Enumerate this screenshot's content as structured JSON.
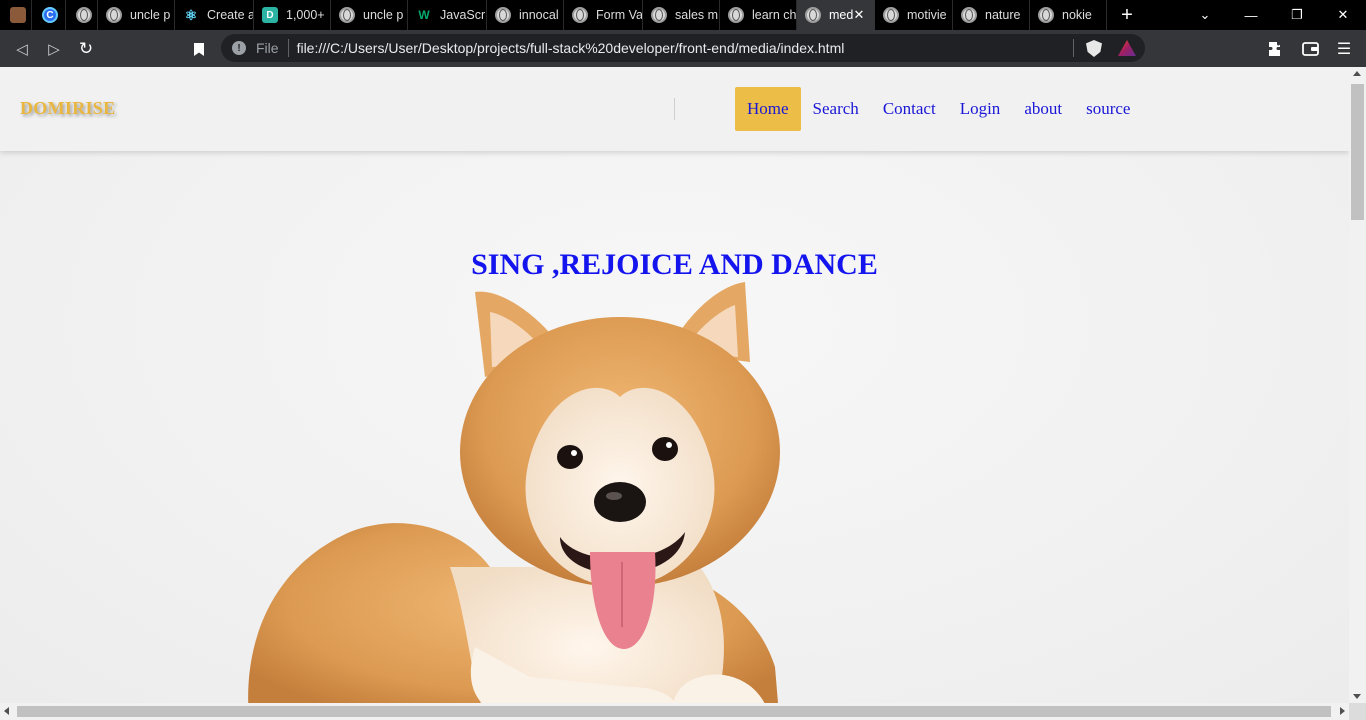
{
  "browser": {
    "tabs": [
      {
        "title": "",
        "icon": "avatar-favicon-icon",
        "pinned": true
      },
      {
        "title": "",
        "icon": "c-favicon-icon",
        "pinned": true
      },
      {
        "title": "",
        "icon": "globe-icon",
        "pinned": true
      },
      {
        "title": "uncle p",
        "icon": "globe-icon"
      },
      {
        "title": "Create a",
        "icon": "react-icon"
      },
      {
        "title": "1,000+",
        "icon": "d-favicon-icon"
      },
      {
        "title": "uncle p",
        "icon": "globe-icon"
      },
      {
        "title": "JavaScr",
        "icon": "w3-icon"
      },
      {
        "title": "innocal",
        "icon": "globe-icon"
      },
      {
        "title": "Form Va",
        "icon": "globe-icon"
      },
      {
        "title": "sales m",
        "icon": "globe-icon"
      },
      {
        "title": "learn ch",
        "icon": "globe-icon"
      },
      {
        "title": "med",
        "icon": "globe-icon",
        "active": true
      },
      {
        "title": "motivie",
        "icon": "globe-icon"
      },
      {
        "title": "nature",
        "icon": "globe-icon"
      },
      {
        "title": "nokie",
        "icon": "globe-icon"
      }
    ],
    "new_tab": "+",
    "window_controls": {
      "dropdown": "⌄",
      "minimize": "—",
      "restore": "❐",
      "close": "✕"
    },
    "address_bar": {
      "scheme_label": "File",
      "url": "file:///C:/Users/User/Desktop/projects/full-stack%20developer/front-end/media/index.html"
    }
  },
  "site": {
    "logo": "DOMIRISE",
    "nav": [
      {
        "label": "Home",
        "active": true
      },
      {
        "label": "Search"
      },
      {
        "label": "Contact"
      },
      {
        "label": "Login"
      },
      {
        "label": "about"
      },
      {
        "label": "source"
      }
    ],
    "hero": {
      "title": "SING ,REJOICE AND DANCE",
      "image": "corgi-dog-image"
    }
  },
  "colors": {
    "accent": "#ecbe48",
    "link": "#1a17d6",
    "hero_text": "#1414ee",
    "logo": "#e9b640"
  }
}
